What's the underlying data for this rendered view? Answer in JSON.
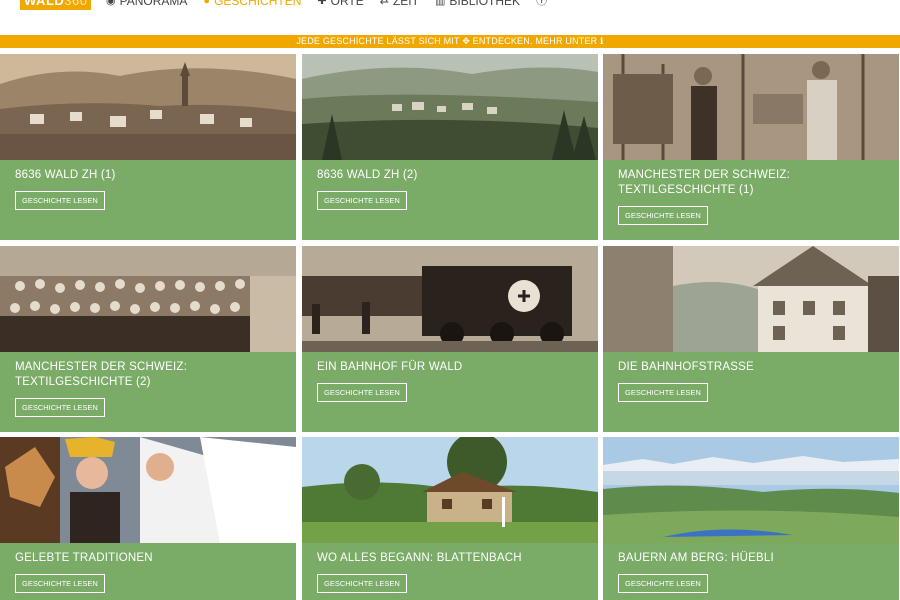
{
  "header": {
    "logo_text": "WALD",
    "logo_number": "360",
    "nav": [
      {
        "label": "Panorama",
        "icon": "eye-icon"
      },
      {
        "label": "Geschichten",
        "icon": "speech-bubble-icon"
      },
      {
        "label": "Orte",
        "icon": "cross-move-icon"
      },
      {
        "label": "Zeit",
        "icon": "arrows-horizontal-icon"
      },
      {
        "label": "Bibliothek",
        "icon": "library-icon"
      }
    ],
    "active_nav": "Geschichten",
    "info_icon": "info-icon"
  },
  "banner": {
    "text": "JEDE GESCHICHTE LÄSST SICH MIT ✥ ENTDECKEN. MEHR UNTER ℹ"
  },
  "colors": {
    "accent": "#f0a800",
    "card_green": "#7aab67"
  },
  "stories": [
    {
      "title": "8636 Wald ZH (1)",
      "button": "Geschichte lesen",
      "image": "sepia town panorama"
    },
    {
      "title": "8636 Wald ZH (2)",
      "button": "Geschichte lesen",
      "image": "valley town painting"
    },
    {
      "title": "Manchester der Schweiz: Textilgeschichte (1)",
      "button": "Geschichte lesen",
      "image": "factory workers"
    },
    {
      "title": "Manchester der Schweiz: Textilgeschichte (2)",
      "button": "Geschichte lesen",
      "image": "group photo"
    },
    {
      "title": "Ein Bahnhof für Wald",
      "button": "Geschichte lesen",
      "image": "steam locomotive"
    },
    {
      "title": "Die Bahnhofstrasse",
      "button": "Geschichte lesen",
      "image": "street with houses"
    },
    {
      "title": "Gelebte Traditionen",
      "button": "Geschichte lesen",
      "image": "masked tradition"
    },
    {
      "title": "Wo alles begann: Blattenbach",
      "button": "Geschichte lesen",
      "image": "farmhouse meadow"
    },
    {
      "title": "Bauern am Berg: Hüebli",
      "button": "Geschichte lesen",
      "image": "alpine view"
    }
  ]
}
